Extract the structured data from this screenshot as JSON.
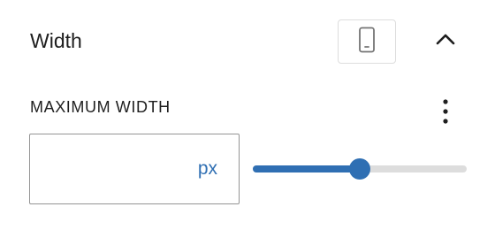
{
  "panel": {
    "title": "Width",
    "device_icon": "mobile-device-icon",
    "collapse_icon": "chevron-up-icon"
  },
  "maximum_width": {
    "label": "MAXIMUM WIDTH",
    "menu_icon": "more-vertical-icon",
    "input_value": "",
    "unit": "px",
    "slider_level": 0.5
  },
  "colors": {
    "accent": "#2f6fb3",
    "text": "#1e1e1e",
    "border": "#949494",
    "rail": "#dddddd"
  }
}
